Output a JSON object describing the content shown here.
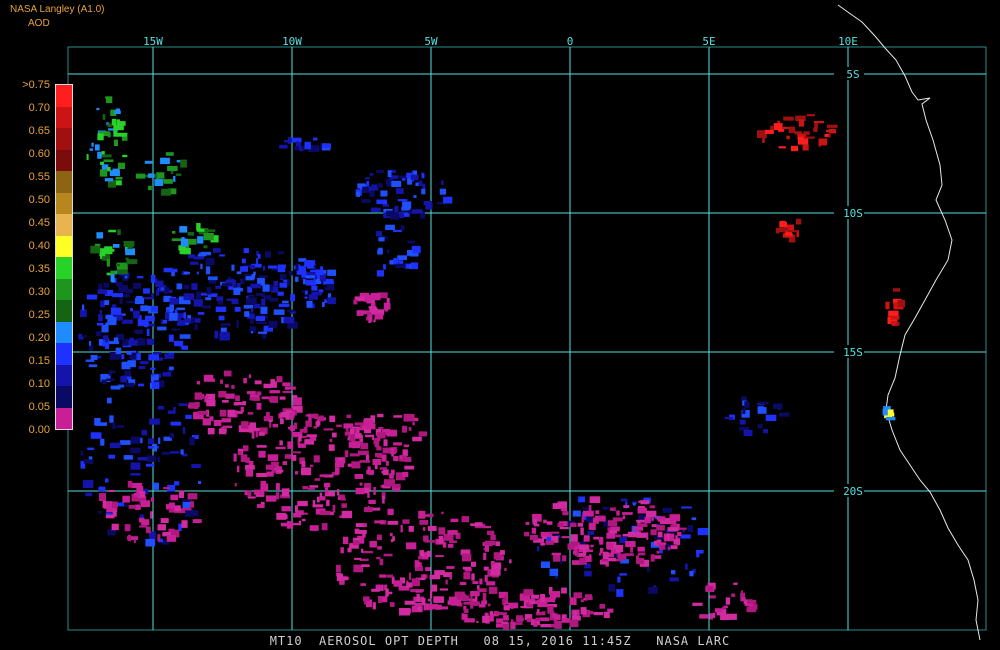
{
  "header": {
    "source": "NASA Langley (A1.0)",
    "variable": "AOD"
  },
  "legend": {
    "labels": [
      ">0.75",
      "0.70",
      "0.65",
      "0.60",
      "0.55",
      "0.50",
      "0.45",
      "0.40",
      "0.35",
      "0.30",
      "0.25",
      "0.20",
      "0.15",
      "0.10",
      "0.05",
      "0.00"
    ],
    "colors": [
      "#ff1e1e",
      "#cc1414",
      "#a01010",
      "#7a0c0c",
      "#8c6414",
      "#b8861e",
      "#e8b450",
      "#ffff28",
      "#28d228",
      "#1e961e",
      "#146414",
      "#1e8cff",
      "#1e32ff",
      "#1414aa",
      "#0a0a64",
      "#c81e96"
    ]
  },
  "map": {
    "grid_color": "#55e0e0",
    "lon_labels": [
      "15W",
      "10W",
      "5W",
      "0",
      "5E",
      "10E"
    ],
    "lat_labels": [
      "5S",
      "10S",
      "15S",
      "20S"
    ]
  },
  "footer": {
    "text": "MT10  AEROSOL OPT DEPTH   08 15, 2016 11:45Z   NASA LARC"
  }
}
